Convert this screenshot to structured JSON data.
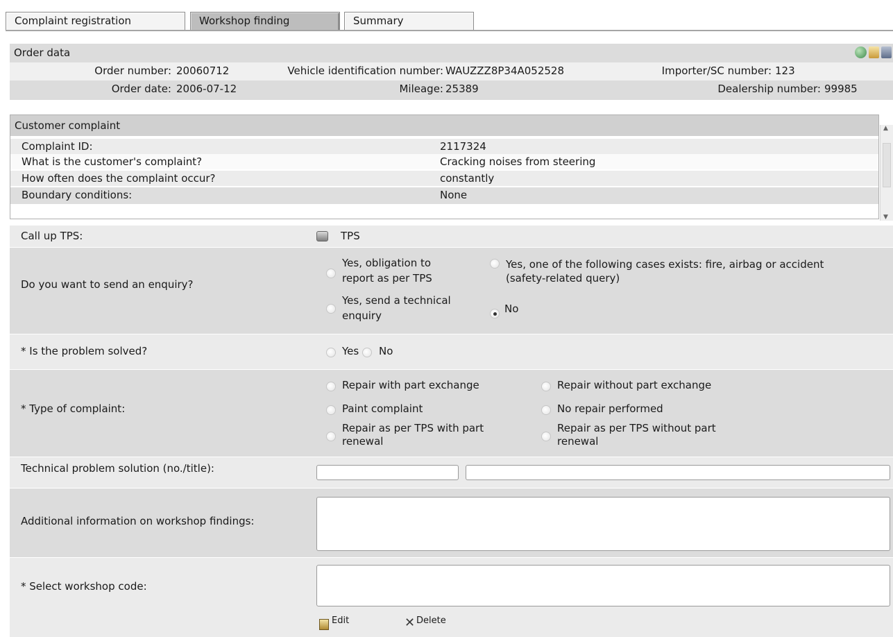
{
  "tabs": [
    "Complaint registration",
    "Workshop finding",
    "Summary"
  ],
  "order": {
    "title": "Order data",
    "order_number_label": "Order number:",
    "order_number": "20060712",
    "vin_label": "Vehicle identification number:",
    "vin": "WAUZZZ8P34A052528",
    "importer_label": "Importer/SC number:",
    "importer": "123",
    "order_date_label": "Order date:",
    "order_date": "2006-07-12",
    "mileage_label": "Mileage:",
    "mileage": "25389",
    "dealership_label": "Dealership number:",
    "dealership": "99985"
  },
  "complaint": {
    "title": "Customer complaint",
    "rows": [
      {
        "label": "Complaint ID:",
        "value": "2117324"
      },
      {
        "label": "What is the customer's complaint?",
        "value": "Cracking noises from steering"
      },
      {
        "label": "How often does the complaint occur?",
        "value": "constantly"
      },
      {
        "label": "Boundary conditions:",
        "value": "None"
      }
    ]
  },
  "form": {
    "tps_label": "Call up TPS:",
    "tps_link": "TPS",
    "enquiry_label": "Do you want to send an enquiry?",
    "enquiry_opt1_l1": "Yes, obligation to",
    "enquiry_opt1_l2": "report as per TPS",
    "enquiry_opt2_l1": "Yes, one of the following cases exists: fire, airbag or accident",
    "enquiry_opt2_l2": "(safety-related query)",
    "enquiry_opt3_l1": "Yes, send a technical",
    "enquiry_opt3_l2": "enquiry",
    "enquiry_opt4": "No",
    "enquiry_selected": "No",
    "solved_label": "* Is the problem solved?",
    "solved_yes": "Yes",
    "solved_no": "No",
    "type_label": "* Type of complaint:",
    "type_opt1": "Repair with part exchange",
    "type_opt2": "Repair without part exchange",
    "type_opt3": "Paint complaint",
    "type_opt4": "No repair performed",
    "type_opt5_l1": "Repair as per TPS with part",
    "type_opt5_l2": "renewal",
    "type_opt6_l1": "Repair as per TPS without part",
    "type_opt6_l2": "renewal",
    "tps_solution_label": "Technical problem solution (no./title):",
    "tps_solution_no": "",
    "tps_solution_title": "",
    "additional_label": "Additional information on workshop findings:",
    "additional_value": "",
    "workshop_code_label": "* Select workshop code:",
    "workshop_code_value": "",
    "edit_label": "Edit",
    "delete_label": "Delete"
  },
  "icons": [
    "globe-icon",
    "document-icon",
    "print-icon",
    "tps-book-icon",
    "edit-icon",
    "delete-icon"
  ]
}
